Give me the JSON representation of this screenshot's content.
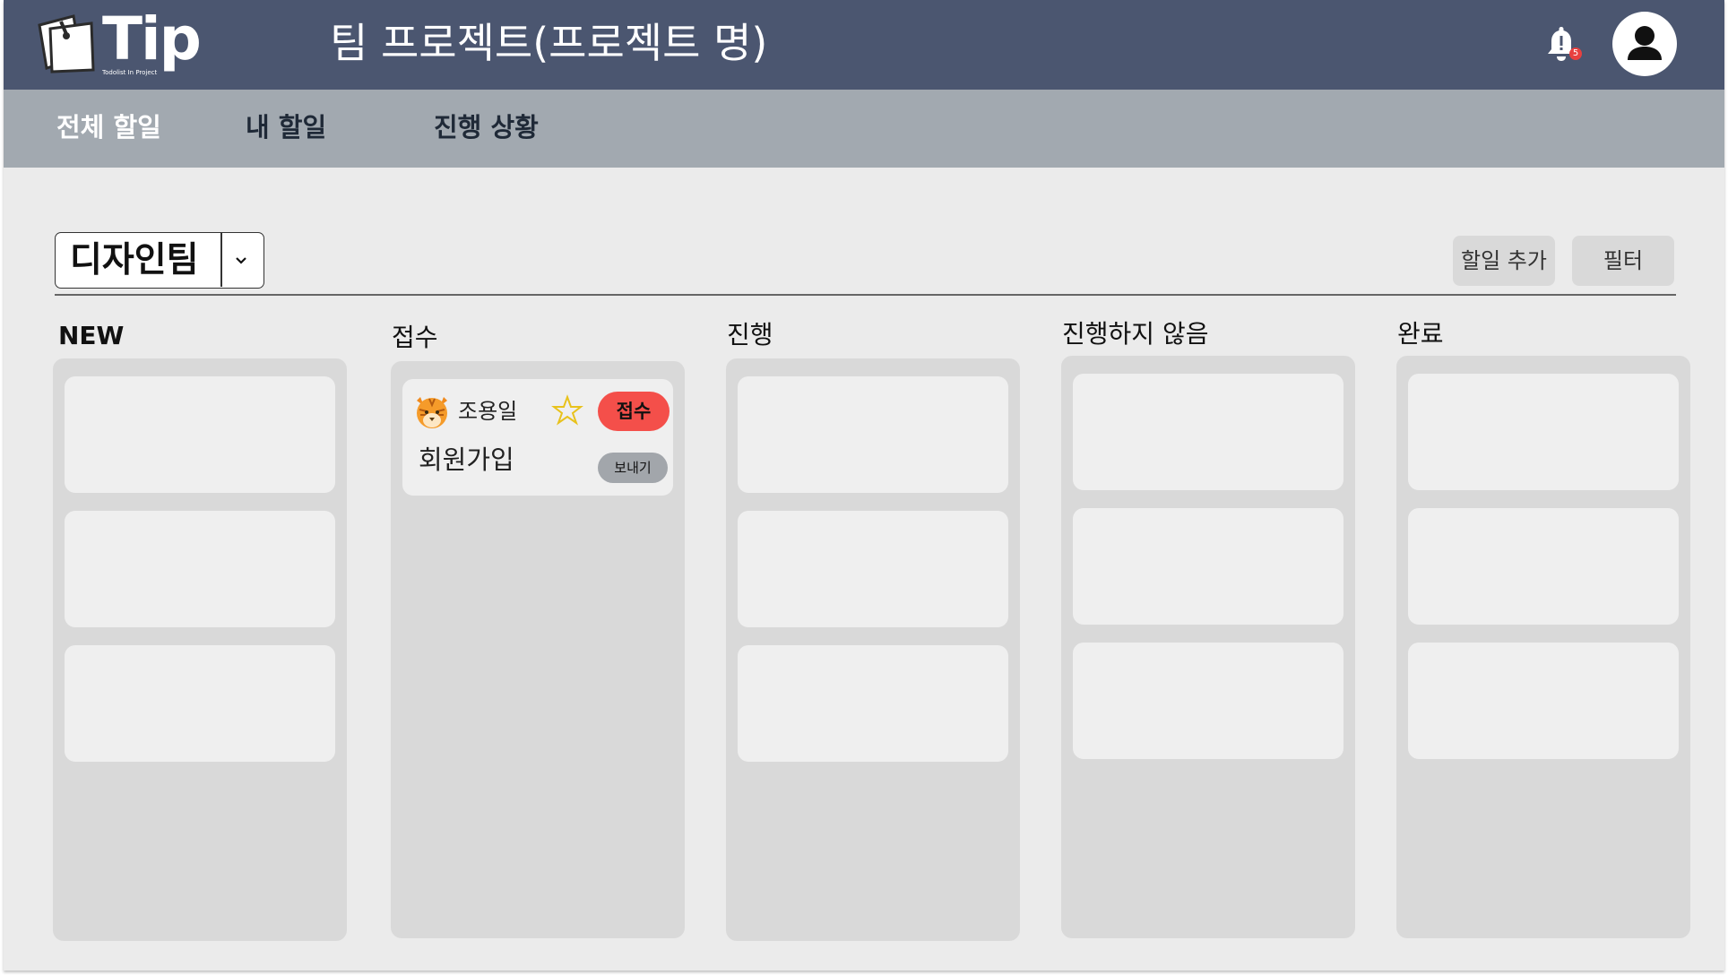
{
  "header": {
    "logo_text": "Tip",
    "logo_tagline": "Todolist In Project",
    "project_title": "팀 프로젝트(프로젝트 명)",
    "notification_count": "5",
    "bg_color": "#4b5670"
  },
  "nav": {
    "items": [
      {
        "label": "전체 할일",
        "active": true
      },
      {
        "label": "내 할일",
        "active": false
      },
      {
        "label": "진행 상황",
        "active": false
      }
    ]
  },
  "toolbar": {
    "team_select_value": "디자인팀",
    "add_task_label": "할일 추가",
    "filter_label": "필터"
  },
  "board": {
    "columns": [
      {
        "title": "NEW",
        "empty_slots": 3
      },
      {
        "title": "접수",
        "empty_slots": 0
      },
      {
        "title": "진행",
        "empty_slots": 3
      },
      {
        "title": "진행하지 않음",
        "empty_slots": 3
      },
      {
        "title": "완료",
        "empty_slots": 3
      }
    ],
    "task_card": {
      "assignee": "조용일",
      "status": "접수",
      "title": "회원가입",
      "send_label": "보내기",
      "status_color": "#f44f4a"
    }
  },
  "icons": [
    "logo-icon",
    "bell-icon",
    "user-icon",
    "chevron-down-icon",
    "star-icon",
    "tiger-avatar-icon"
  ]
}
